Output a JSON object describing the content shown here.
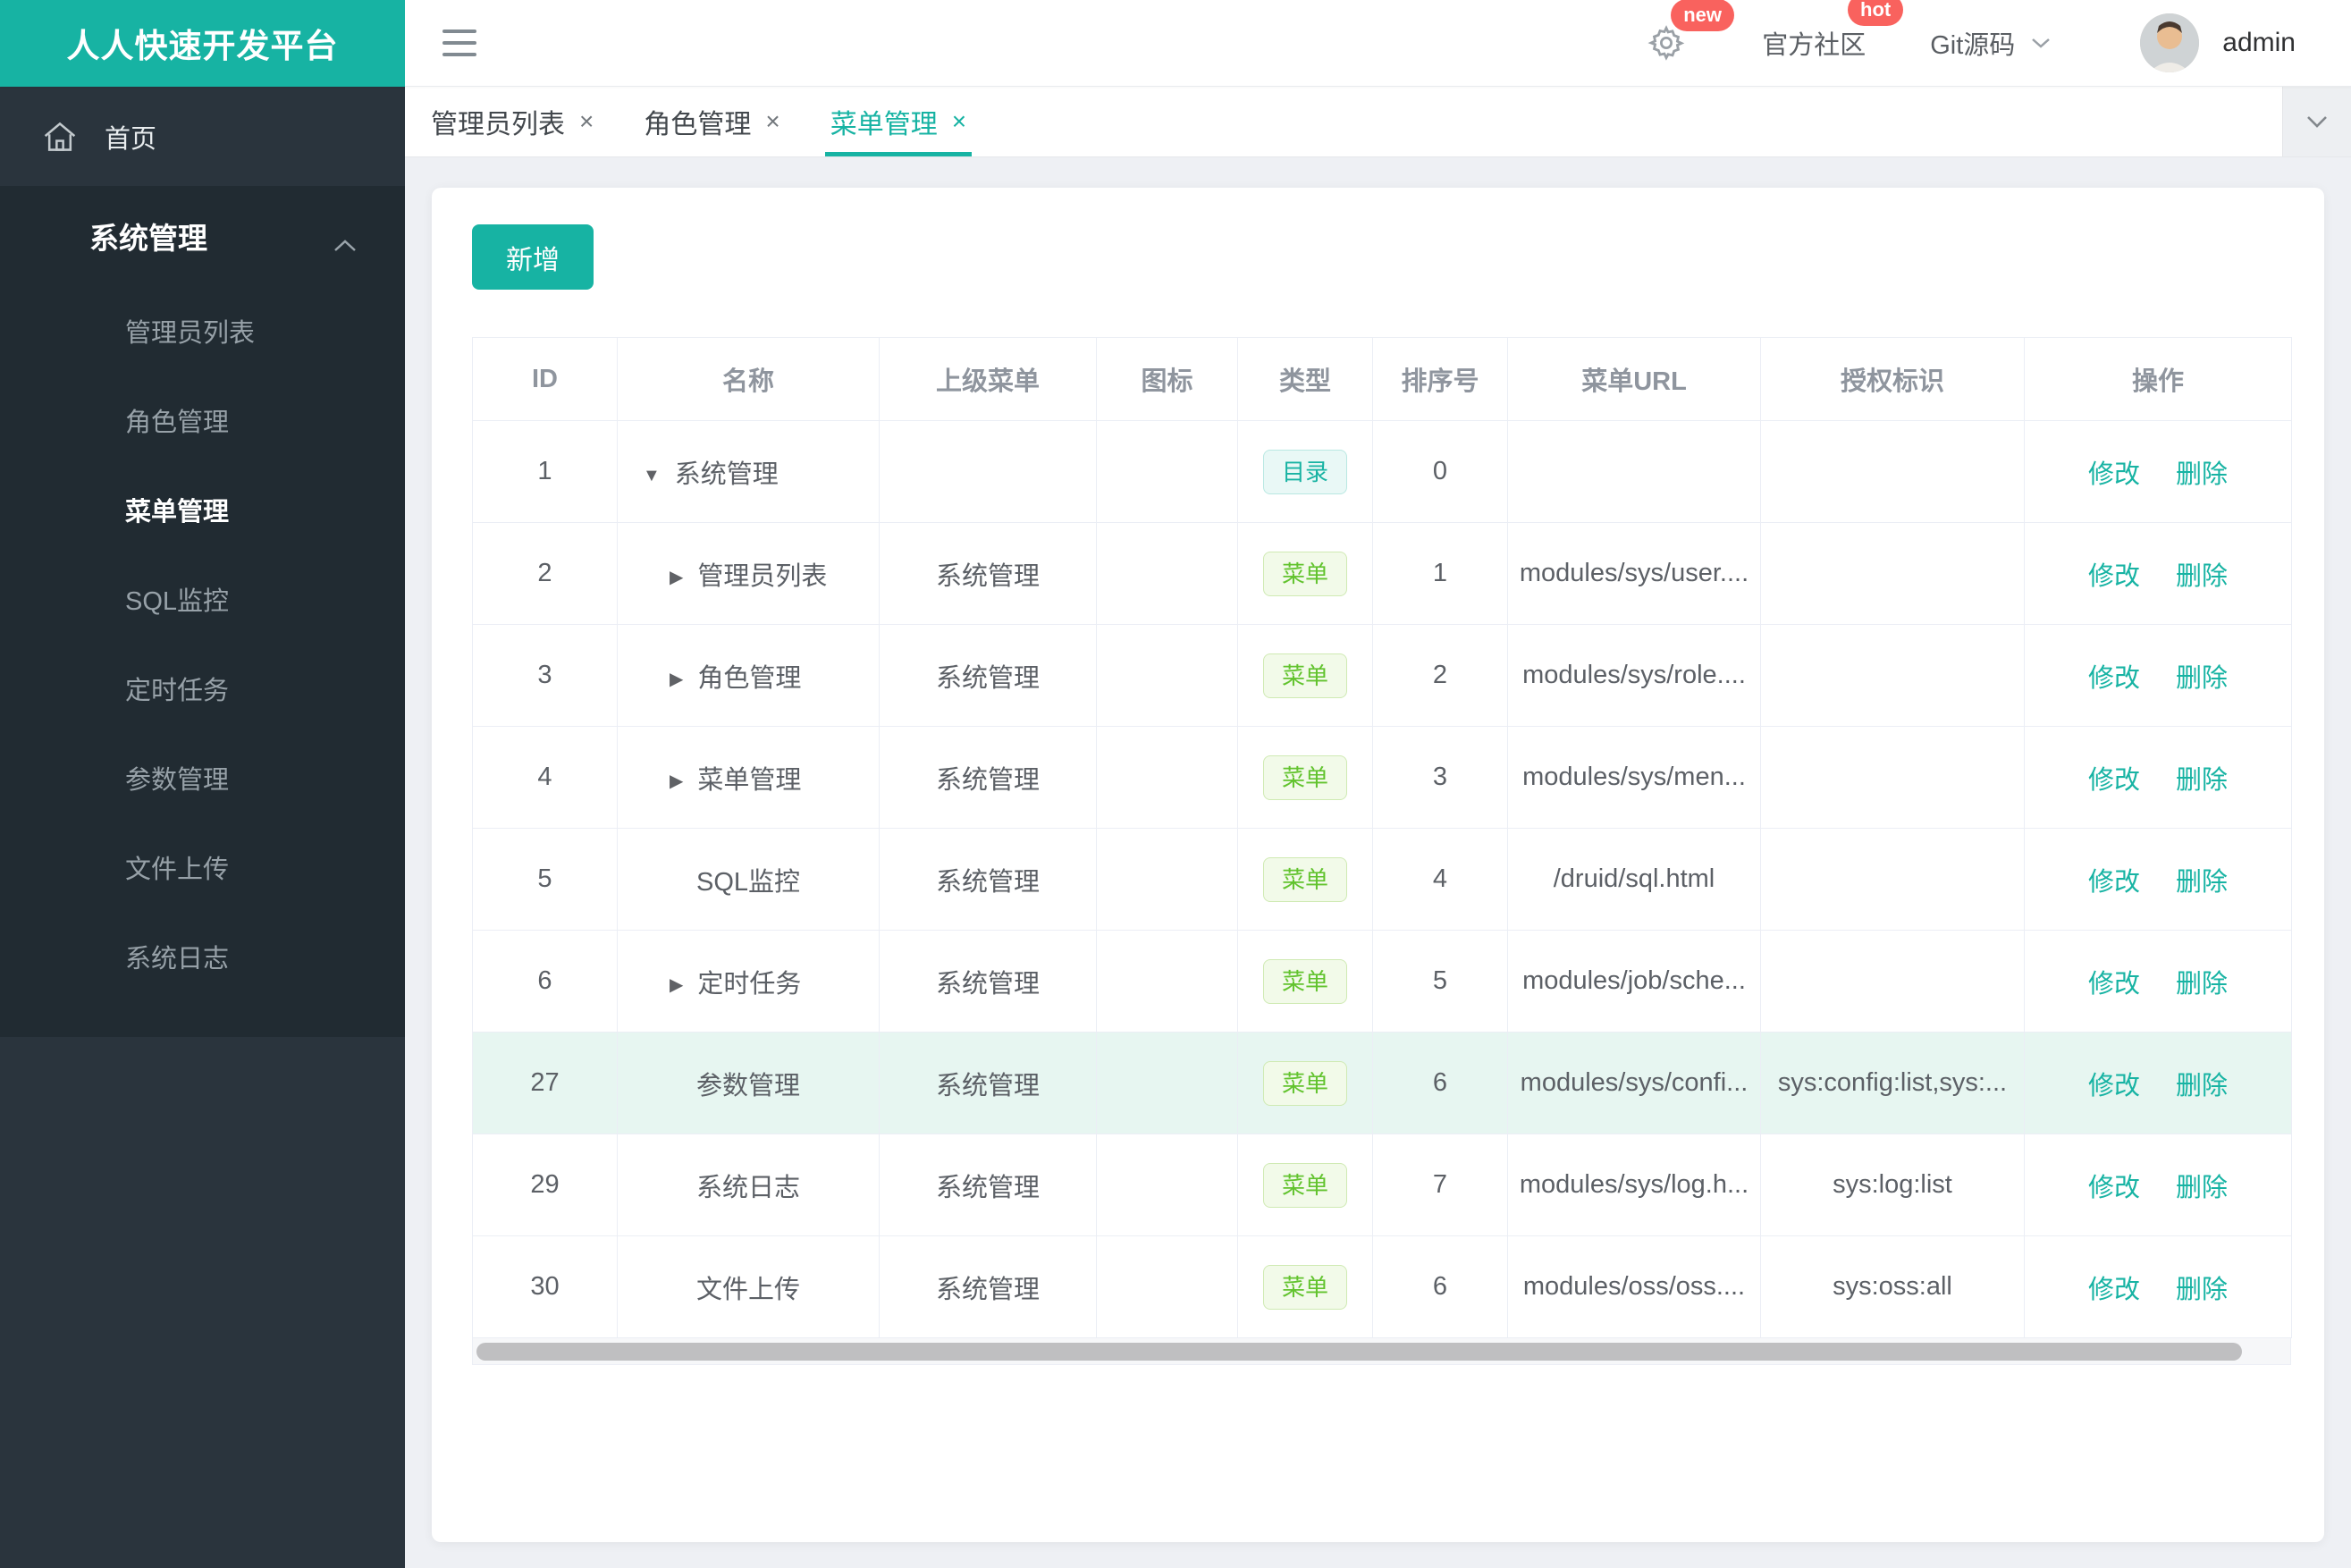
{
  "brand": {
    "title": "人人快速开发平台"
  },
  "header": {
    "gear_badge": "new",
    "community_label": "官方社区",
    "community_badge": "hot",
    "git_label": "Git源码",
    "user": "admin"
  },
  "tabs": [
    {
      "label": "管理员列表",
      "close": "×",
      "active": false
    },
    {
      "label": "角色管理",
      "close": "×",
      "active": false
    },
    {
      "label": "菜单管理",
      "close": "×",
      "active": true
    }
  ],
  "sidebar": {
    "home_label": "首页",
    "section_label": "系统管理",
    "items": [
      {
        "label": "管理员列表",
        "active": false
      },
      {
        "label": "角色管理",
        "active": false
      },
      {
        "label": "菜单管理",
        "active": true
      },
      {
        "label": "SQL监控",
        "active": false
      },
      {
        "label": "定时任务",
        "active": false
      },
      {
        "label": "参数管理",
        "active": false
      },
      {
        "label": "文件上传",
        "active": false
      },
      {
        "label": "系统日志",
        "active": false
      }
    ]
  },
  "toolbar": {
    "add_label": "新增"
  },
  "table": {
    "columns": [
      "ID",
      "名称",
      "上级菜单",
      "图标",
      "类型",
      "排序号",
      "菜单URL",
      "授权标识",
      "操作"
    ],
    "type_labels": {
      "dir": "目录",
      "menu": "菜单"
    },
    "actions": {
      "edit": "修改",
      "delete": "删除"
    },
    "rows": [
      {
        "id": "1",
        "arrow": "down",
        "name": "系统管理",
        "parent": "",
        "type": "dir",
        "order": "0",
        "url": "",
        "perms": "",
        "highlighted": false
      },
      {
        "id": "2",
        "arrow": "right",
        "name": "管理员列表",
        "parent": "系统管理",
        "type": "menu",
        "order": "1",
        "url": "modules/sys/user....",
        "perms": "",
        "highlighted": false
      },
      {
        "id": "3",
        "arrow": "right",
        "name": "角色管理",
        "parent": "系统管理",
        "type": "menu",
        "order": "2",
        "url": "modules/sys/role....",
        "perms": "",
        "highlighted": false
      },
      {
        "id": "4",
        "arrow": "right",
        "name": "菜单管理",
        "parent": "系统管理",
        "type": "menu",
        "order": "3",
        "url": "modules/sys/men...",
        "perms": "",
        "highlighted": false
      },
      {
        "id": "5",
        "arrow": "none",
        "name": "SQL监控",
        "parent": "系统管理",
        "type": "menu",
        "order": "4",
        "url": "/druid/sql.html",
        "perms": "",
        "highlighted": false
      },
      {
        "id": "6",
        "arrow": "right",
        "name": "定时任务",
        "parent": "系统管理",
        "type": "menu",
        "order": "5",
        "url": "modules/job/sche...",
        "perms": "",
        "highlighted": false
      },
      {
        "id": "27",
        "arrow": "none",
        "name": "参数管理",
        "parent": "系统管理",
        "type": "menu",
        "order": "6",
        "url": "modules/sys/confi...",
        "perms": "sys:config:list,sys:...",
        "highlighted": true
      },
      {
        "id": "29",
        "arrow": "none",
        "name": "系统日志",
        "parent": "系统管理",
        "type": "menu",
        "order": "7",
        "url": "modules/sys/log.h...",
        "perms": "sys:log:list",
        "highlighted": false
      },
      {
        "id": "30",
        "arrow": "none",
        "name": "文件上传",
        "parent": "系统管理",
        "type": "menu",
        "order": "6",
        "url": "modules/oss/oss....",
        "perms": "sys:oss:all",
        "highlighted": false
      }
    ]
  },
  "colors": {
    "accent": "#17b3a3",
    "badge_red": "#f9625e",
    "tag_dir_text": "#18b3a3",
    "tag_menu_text": "#62c32e",
    "row_highlight": "#e7f6f1",
    "sidebar_bg": "#2a343d"
  }
}
